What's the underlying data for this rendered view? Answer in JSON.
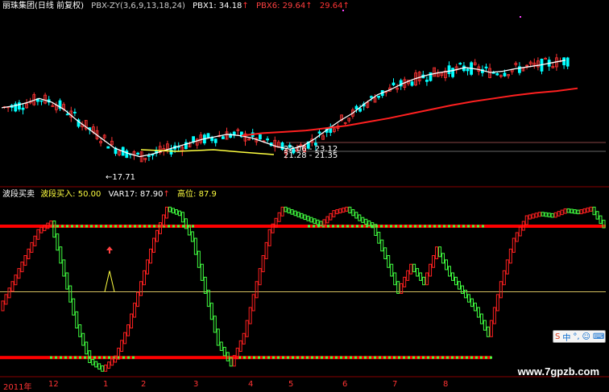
{
  "top_legend": {
    "stock": "丽珠集团(日线 前复权)",
    "indicator": "PBX-ZY(3,6,9,13,18,24)",
    "pbx1_label": "PBX1: 34.18",
    "pbx6_label": "PBX6: 29.64",
    "extra_value": "29.64"
  },
  "bottom_legend": {
    "name": "波段买卖",
    "buy_label": "波段买入: 50.00",
    "var17_label": "VAR17: 87.90",
    "high_label": "高位: 87.9"
  },
  "annotations": {
    "low_price": "←17.71",
    "range_1": "22.06 - 23.12",
    "range_2": "21.28 - 21.35"
  },
  "time_axis": [
    "2011年",
    "12",
    "1",
    "2",
    "3",
    "4",
    "5",
    "6",
    "7",
    "8"
  ],
  "watermark": "www.7gpzb.com",
  "ime": {
    "char": "中"
  },
  "colors": {
    "up": "#ff3333",
    "down": "#00ffff",
    "pbx1": "#ffffff",
    "pbx6": "#ff2020",
    "yellow": "#ffff40",
    "osc_up": "#ff2020",
    "osc_down": "#40ff40",
    "band_line": "#ff0000"
  },
  "chart_data": [
    {
      "type": "candlestick",
      "title": "丽珠集团(日线 前复权)",
      "series": [
        {
          "name": "PBX1",
          "values": [
            26.5,
            26.8,
            27.3,
            28.0,
            27.4,
            26.2,
            24.5,
            23.0,
            21.5,
            20.0,
            19.2,
            18.6,
            19.0,
            19.6,
            20.2,
            20.8,
            21.4,
            21.8,
            22.2,
            22.0,
            21.6,
            20.9,
            20.2,
            19.8,
            20.3,
            21.5,
            23.0,
            24.4,
            25.6,
            27.2,
            28.6,
            29.4,
            30.4,
            31.2,
            31.8,
            32.2,
            32.5,
            33.0,
            32.7,
            32.2,
            32.4,
            32.8,
            33.1,
            33.4,
            33.8,
            34.18
          ]
        },
        {
          "name": "PBX6",
          "values": [
            22.0,
            22.4,
            22.6,
            22.8,
            23.2,
            23.6,
            24.2,
            24.8,
            25.5,
            26.2,
            26.9,
            27.5,
            28.0,
            28.5,
            28.9,
            29.2,
            29.64
          ]
        }
      ]
    },
    {
      "type": "line",
      "title": "波段买卖",
      "ylim": [
        0,
        100
      ],
      "reference_levels": [
        {
          "name": "高位",
          "value": 87.9
        },
        {
          "name": "波段买入",
          "value": 50.0
        },
        {
          "name": "",
          "value": 12.0
        }
      ],
      "series": [
        {
          "name": "VAR17",
          "values": [
            40,
            55,
            70,
            85,
            90,
            60,
            30,
            10,
            5,
            12,
            30,
            55,
            80,
            98,
            95,
            80,
            50,
            20,
            8,
            25,
            55,
            85,
            98,
            95,
            92,
            89,
            96,
            98,
            92,
            88,
            70,
            50,
            65,
            55,
            75,
            60,
            50,
            40,
            25,
            55,
            80,
            93,
            95,
            94,
            97,
            96,
            98,
            87.9
          ]
        }
      ]
    }
  ]
}
